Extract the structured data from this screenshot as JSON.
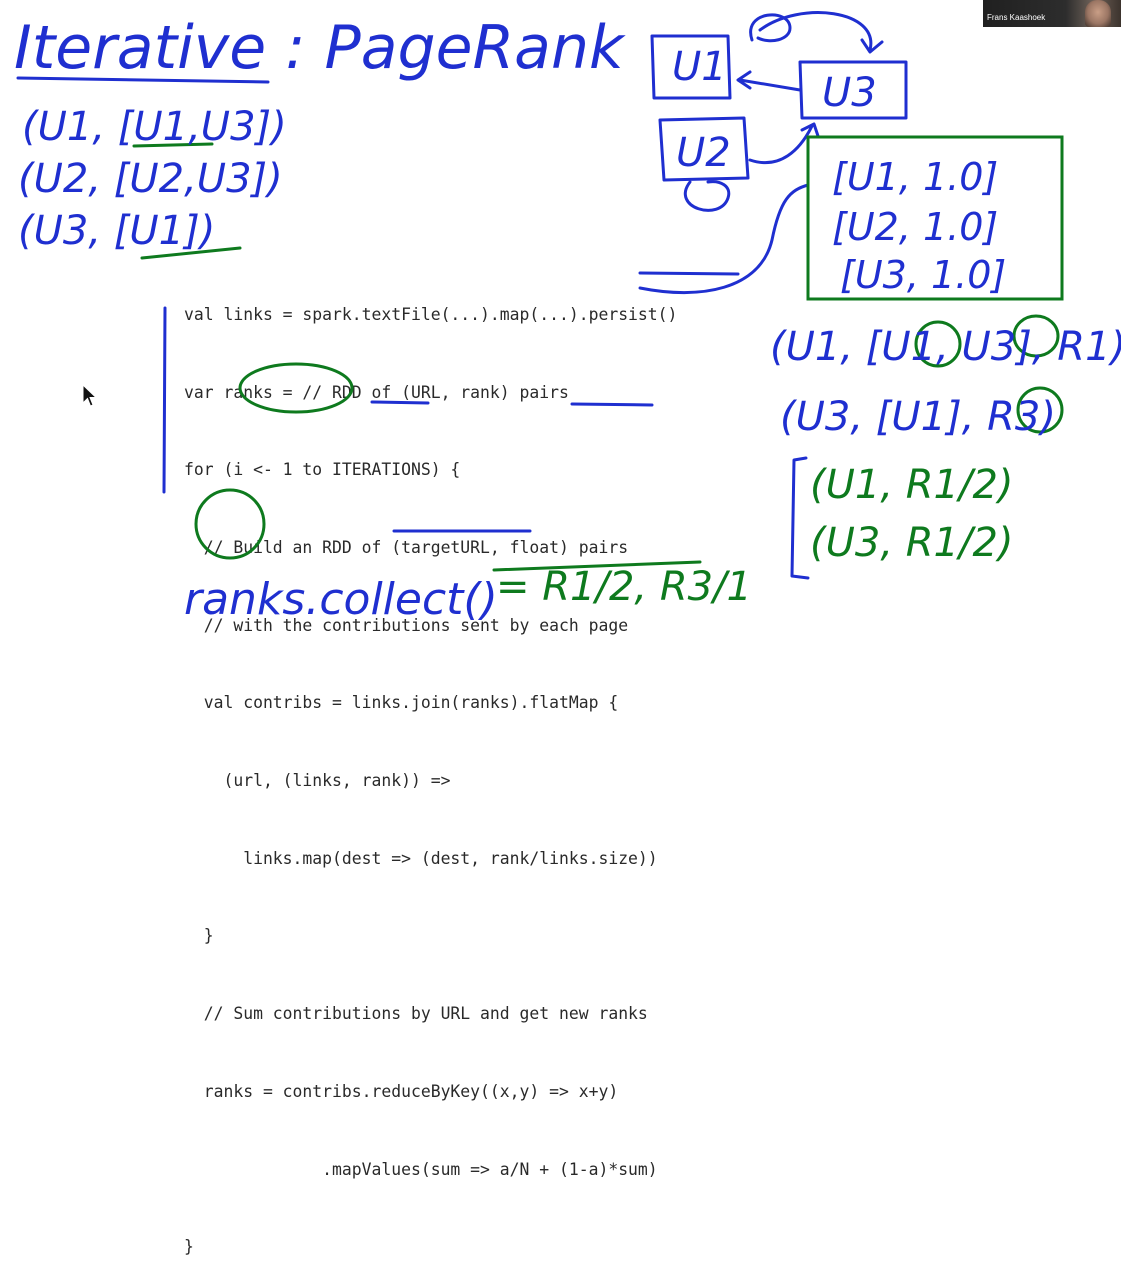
{
  "video": {
    "participant_name": "Frans Kaashoek"
  },
  "colors": {
    "ink_blue": "#1f2fd0",
    "ink_green": "#0e7a1e",
    "code_text": "#2a2a2a"
  },
  "handwriting": {
    "title": "Iterative : PageRank",
    "left_links": [
      "(U1, [U1,U3])",
      "(U2, [U2,U3])",
      "(U3, [U1])"
    ],
    "graph_nodes": [
      "U1",
      "U2",
      "U3"
    ],
    "rank_box": [
      "[U1, 1.0]",
      "[U2, 1.0]",
      "[U3, 1.0]"
    ],
    "join_results": [
      "(U1, [U1, U3], R1)",
      "(U3, [U1], R3)"
    ],
    "contribs": [
      "(U1, R1/2)",
      "(U3, R1/2)"
    ],
    "collect": "ranks.collect()",
    "collect_result": "= R1/2, R3/1"
  },
  "code": {
    "lines": [
      "val links = spark.textFile(...).map(...).persist()",
      "var ranks = // RDD of (URL, rank) pairs",
      "for (i <- 1 to ITERATIONS) {",
      "  // Build an RDD of (targetURL, float) pairs",
      "  // with the contributions sent by each page",
      "  val contribs = links.join(ranks).flatMap {",
      "    (url, (links, rank)) =>",
      "      links.map(dest => (dest, rank/links.size))",
      "  }",
      "  // Sum contributions by URL and get new ranks",
      "  ranks = contribs.reduceByKey((x,y) => x+y)",
      "              .mapValues(sum => a/N + (1-a)*sum)",
      "}"
    ]
  }
}
